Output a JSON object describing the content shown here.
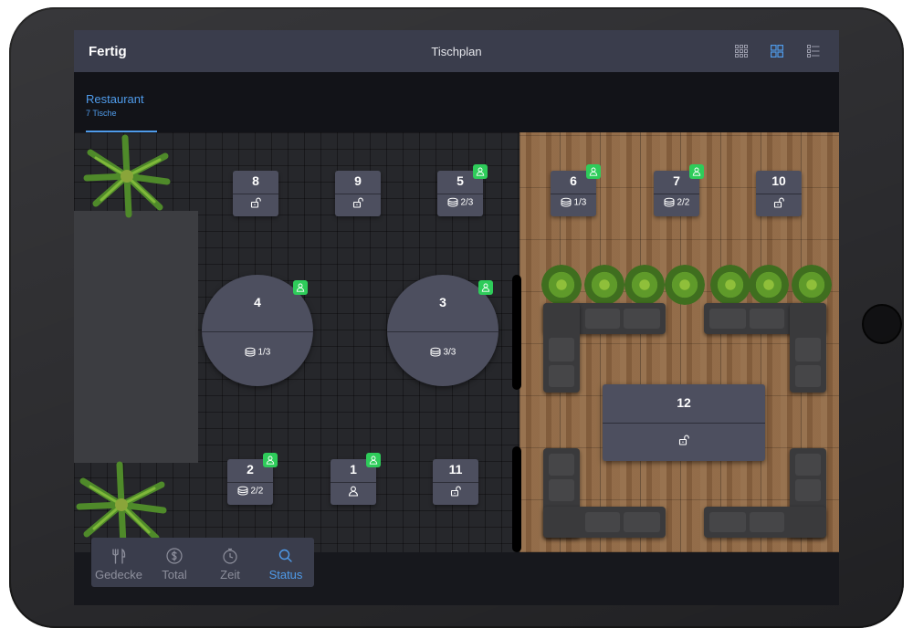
{
  "header": {
    "done_label": "Fertig",
    "title": "Tischplan",
    "view_icons": [
      "grid-small-icon",
      "grid-large-icon",
      "list-icon"
    ],
    "active_view": "grid-large-icon"
  },
  "room_tab": {
    "name": "Restaurant",
    "subtitle": "7 Tische"
  },
  "tables": [
    {
      "id": "8",
      "number": "8",
      "shape": "square",
      "status": "free",
      "info": ""
    },
    {
      "id": "9",
      "number": "9",
      "shape": "square",
      "status": "free",
      "info": ""
    },
    {
      "id": "5",
      "number": "5",
      "shape": "square",
      "status": "occupied",
      "info": "2/3"
    },
    {
      "id": "6",
      "number": "6",
      "shape": "square",
      "status": "occupied",
      "info": "1/3"
    },
    {
      "id": "7",
      "number": "7",
      "shape": "square",
      "status": "occupied",
      "info": "2/2"
    },
    {
      "id": "10",
      "number": "10",
      "shape": "square",
      "status": "free",
      "info": ""
    },
    {
      "id": "4",
      "number": "4",
      "shape": "round",
      "status": "occupied",
      "info": "1/3"
    },
    {
      "id": "3",
      "number": "3",
      "shape": "round",
      "status": "occupied",
      "info": "3/3"
    },
    {
      "id": "12",
      "number": "12",
      "shape": "rect",
      "status": "free",
      "info": ""
    },
    {
      "id": "2",
      "number": "2",
      "shape": "square",
      "status": "occupied",
      "info": "2/2"
    },
    {
      "id": "1",
      "number": "1",
      "shape": "square",
      "status": "reserved",
      "info": ""
    },
    {
      "id": "11",
      "number": "11",
      "shape": "square",
      "status": "free",
      "info": ""
    }
  ],
  "tabbar": {
    "items": [
      {
        "label": "Gedecke",
        "icon": "cutlery-icon"
      },
      {
        "label": "Total",
        "icon": "dollar-icon"
      },
      {
        "label": "Zeit",
        "icon": "stopwatch-icon"
      },
      {
        "label": "Status",
        "icon": "search-icon"
      }
    ],
    "active": "Status"
  },
  "colors": {
    "accent": "#4f9bea",
    "badge_green": "#2ecc5a",
    "table_fill": "#4d4f5f",
    "header_bg": "#3a3d4c"
  }
}
